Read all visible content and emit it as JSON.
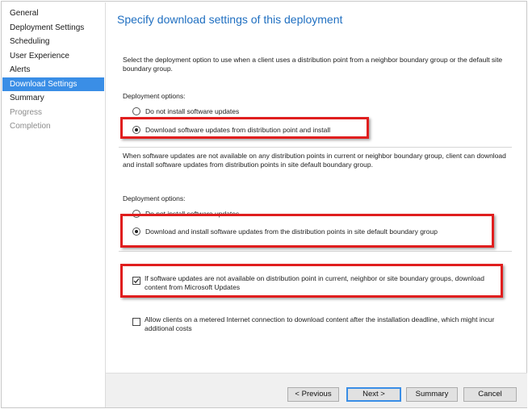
{
  "sidebar": {
    "items": [
      {
        "label": "General",
        "state": "normal"
      },
      {
        "label": "Deployment Settings",
        "state": "normal"
      },
      {
        "label": "Scheduling",
        "state": "normal"
      },
      {
        "label": "User Experience",
        "state": "normal"
      },
      {
        "label": "Alerts",
        "state": "normal"
      },
      {
        "label": "Download Settings",
        "state": "active"
      },
      {
        "label": "Summary",
        "state": "normal"
      },
      {
        "label": "Progress",
        "state": "disabled"
      },
      {
        "label": "Completion",
        "state": "disabled"
      }
    ]
  },
  "main": {
    "title": "Specify download settings of this deployment",
    "intro": "Select the deployment option to use when a client uses a distribution point from a neighbor boundary group or the default site boundary group.",
    "section1": {
      "label": "Deployment options:",
      "options": [
        {
          "label": "Do not install software updates",
          "checked": false
        },
        {
          "label": "Download software updates from distribution point and install",
          "checked": true
        }
      ]
    },
    "note": "When software updates are not available on any distribution points in current or neighbor boundary group, client can download and install software updates from distribution points in site default boundary group.",
    "section2": {
      "label": "Deployment options:",
      "options": [
        {
          "label": "Do not install software updates",
          "checked": false
        },
        {
          "label": "Download and install software updates from the distribution points in site default boundary group",
          "checked": true
        }
      ]
    },
    "checkboxes": [
      {
        "label": "If software updates are not available on distribution point in current, neighbor or site boundary groups, download content from Microsoft Updates",
        "checked": true
      },
      {
        "label": "Allow clients on a metered Internet connection to download content after the installation deadline, which might incur additional costs",
        "checked": false
      }
    ]
  },
  "footer": {
    "previous": "< Previous",
    "next": "Next >",
    "summary": "Summary",
    "cancel": "Cancel"
  },
  "colors": {
    "accent": "#3a8ee6",
    "title": "#1f6fc1",
    "highlight": "#e01e1e"
  }
}
